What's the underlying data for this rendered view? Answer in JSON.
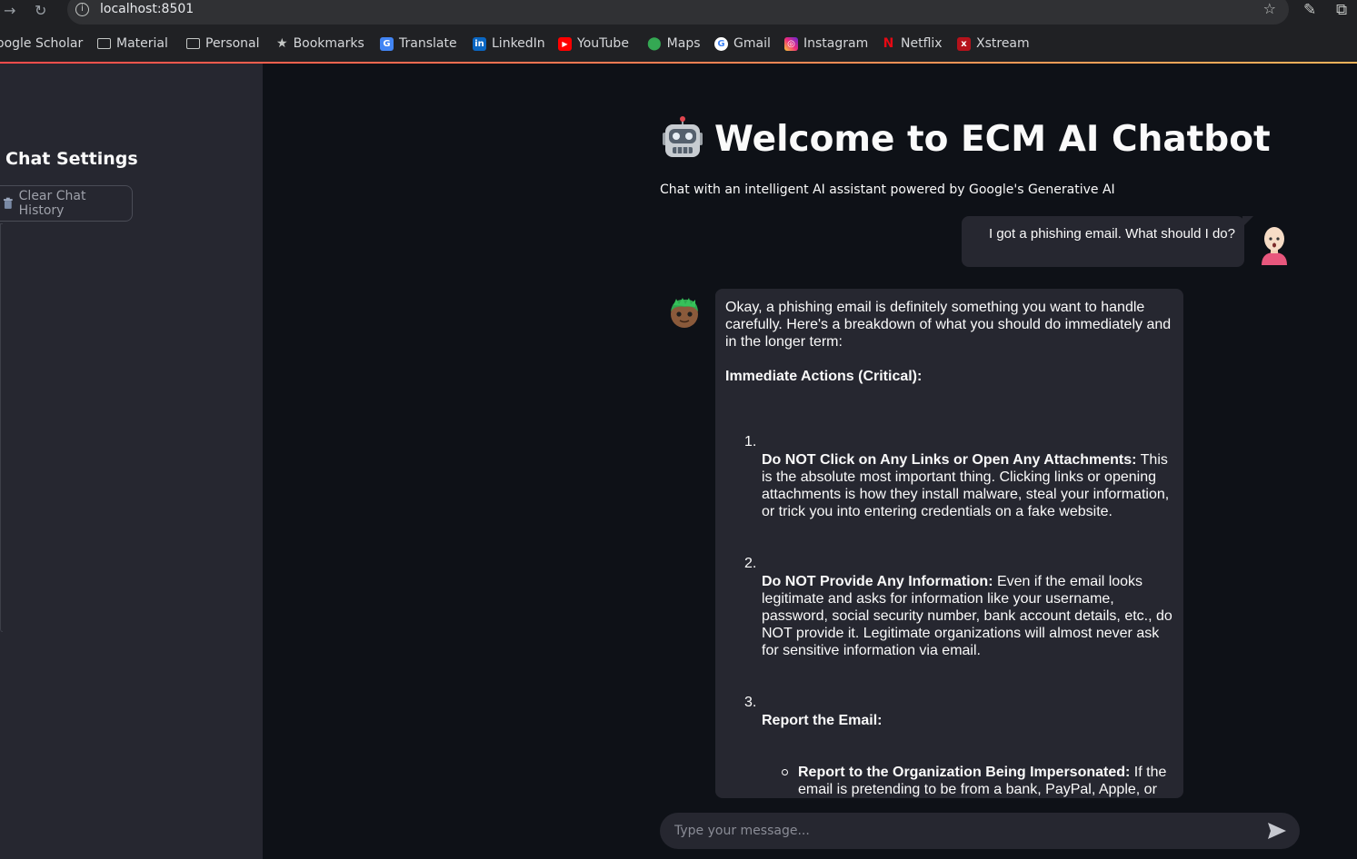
{
  "browser": {
    "url": "localhost:8501",
    "bookmarks": [
      {
        "label": "oogle Scholar",
        "icon": "none"
      },
      {
        "label": "Material",
        "icon": "folder-icon"
      },
      {
        "label": "Personal",
        "icon": "folder-icon"
      },
      {
        "label": "Bookmarks",
        "icon": "star-icon"
      },
      {
        "label": "Translate",
        "icon": "translate-icon"
      },
      {
        "label": "LinkedIn",
        "icon": "linkedin-icon"
      },
      {
        "label": "YouTube",
        "icon": "youtube-icon"
      },
      {
        "label": "Maps",
        "icon": "maps-icon"
      },
      {
        "label": "Gmail",
        "icon": "google-icon"
      },
      {
        "label": "Instagram",
        "icon": "instagram-icon"
      },
      {
        "label": "Netflix",
        "icon": "netflix-icon"
      },
      {
        "label": "Xstream",
        "icon": "xstream-icon"
      }
    ]
  },
  "sidebar": {
    "title": "Chat Settings",
    "clear_button": "Clear Chat History"
  },
  "main": {
    "title": "Welcome to ECM AI Chatbot",
    "subtitle": "Chat with an intelligent AI assistant powered by Google's Generative AI",
    "messages": {
      "user": "I got a phishing email. What should I do?",
      "assistant": {
        "intro": "Okay, a phishing email is definitely something you want to handle carefully. Here's a breakdown of what you should do immediately and in the longer term:",
        "heading": "Immediate Actions (Critical):",
        "items": [
          {
            "num": "1.",
            "title": "Do NOT Click on Any Links or Open Any Attachments:",
            "text": " This is the absolute most important thing. Clicking links or opening attachments is how they install malware, steal your information, or trick you into entering credentials on a fake website."
          },
          {
            "num": "2.",
            "title": "Do NOT Provide Any Information:",
            "text": " Even if the email looks legitimate and asks for information like your username, password, social security number, bank account details, etc., do NOT provide it. Legitimate organizations will almost never ask for sensitive information via email."
          },
          {
            "num": "3.",
            "title": "Report the Email:",
            "text": ""
          }
        ],
        "sub_item": {
          "title": "Report to the Organization Being Impersonated:",
          "text": " If the email is pretending to be from a bank, PayPal, Apple, or"
        }
      }
    },
    "input_placeholder": "Type your message..."
  },
  "colors": {
    "app_bg": "#0e1117",
    "sidebar_bg": "#262730",
    "bubble_bg": "#262730",
    "text": "#fafafa",
    "accent": "#ff4b4b"
  }
}
